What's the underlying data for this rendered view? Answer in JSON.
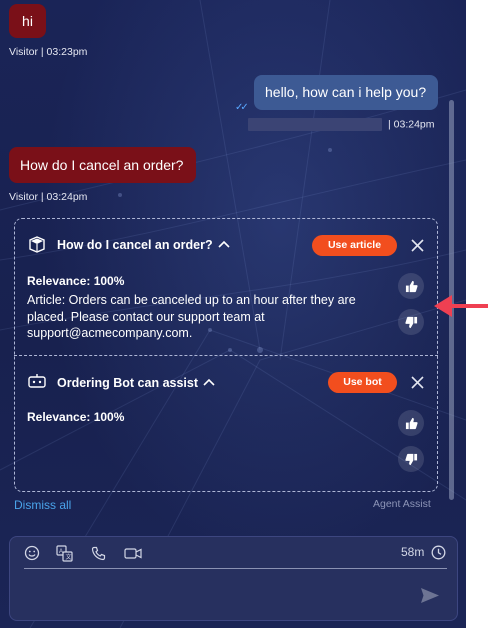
{
  "messages": {
    "visitor_1": {
      "text": "hi",
      "meta": "Visitor | 03:23pm"
    },
    "agent_1": {
      "text": "hello, how can i help you?",
      "time": "| 03:24pm"
    },
    "visitor_2": {
      "text": "How do I cancel an order?",
      "meta": "Visitor | 03:24pm"
    }
  },
  "assist": {
    "article": {
      "title": "How do I cancel an order?",
      "button": "Use article",
      "relevance": "Relevance: 100%",
      "body": "Article: Orders can be canceled up to an hour after they are placed. Please contact our support team at support@acmecompany.com."
    },
    "bot": {
      "title": "Ordering Bot can assist",
      "button": "Use bot",
      "relevance": "Relevance: 100%"
    },
    "dismiss_label": "Dismiss all",
    "footer_label": "Agent Assist"
  },
  "composer": {
    "timer": "58m",
    "icons": [
      "emoji-icon",
      "translate-icon",
      "phone-icon",
      "video-icon",
      "clock-icon",
      "send-icon"
    ]
  },
  "colors": {
    "visitor_bubble": "#7a1018",
    "agent_bubble": "#3d5a94",
    "accent": "#f24e1e",
    "link": "#4aa3ea",
    "annotation_arrow": "#ef4052"
  }
}
